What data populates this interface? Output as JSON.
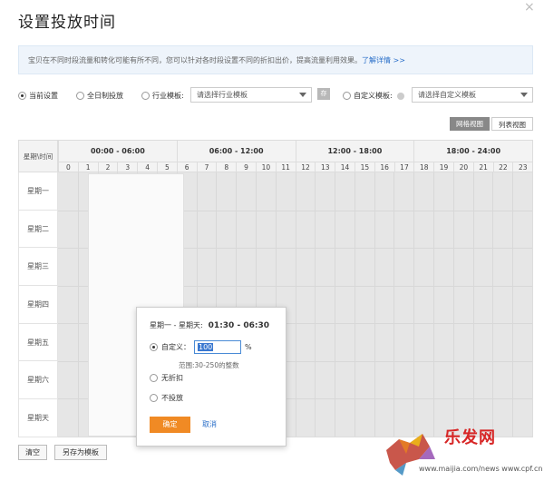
{
  "dialog": {
    "title": "设置投放时间",
    "close_glyph": "×"
  },
  "notice": {
    "text": "宝贝在不同时段流量和转化可能有所不同，您可以针对各时段设置不同的折扣出价，提高流量利用效果。",
    "link": "了解详情 >>"
  },
  "options": {
    "current": "当前设置",
    "allday": "全日制投放",
    "industry": "行业模板:",
    "industry_select": "请选择行业模板",
    "save_tpl": "存",
    "custom": "自定义模板:",
    "custom_select": "请选择自定义模板",
    "selected": "current"
  },
  "views": {
    "grid": "网格视图",
    "list": "列表视图",
    "active": "grid"
  },
  "grid": {
    "corner": "星期\\时间",
    "ranges": [
      "00:00 - 06:00",
      "06:00 - 12:00",
      "12:00 - 18:00",
      "18:00 - 24:00"
    ],
    "hours": [
      "0",
      "1",
      "2",
      "3",
      "4",
      "5",
      "6",
      "7",
      "8",
      "9",
      "10",
      "11",
      "12",
      "13",
      "14",
      "15",
      "16",
      "17",
      "18",
      "19",
      "20",
      "21",
      "22",
      "23"
    ],
    "days": [
      "星期一",
      "星期二",
      "星期三",
      "星期四",
      "星期五",
      "星期六",
      "星期天"
    ]
  },
  "popup": {
    "range_label": "星期一 - 星期天:",
    "range_time": "01:30 - 06:30",
    "custom_label": "自定义：",
    "custom_value": "100",
    "unit": "%",
    "hint": "范围:30-250的整数",
    "no_discount": "无折扣",
    "no_delivery": "不投放",
    "ok": "确定",
    "cancel": "取消"
  },
  "footer": {
    "clear": "清空",
    "save_as_template": "另存为模板"
  },
  "watermark": {
    "logo_text": "乐发网",
    "url": "www.maijia.com/news  www.cpf.cn"
  },
  "colors": {
    "accent_orange": "#f08a24",
    "link_blue": "#2a6fc9",
    "cell_gray": "#e6e6e6"
  }
}
